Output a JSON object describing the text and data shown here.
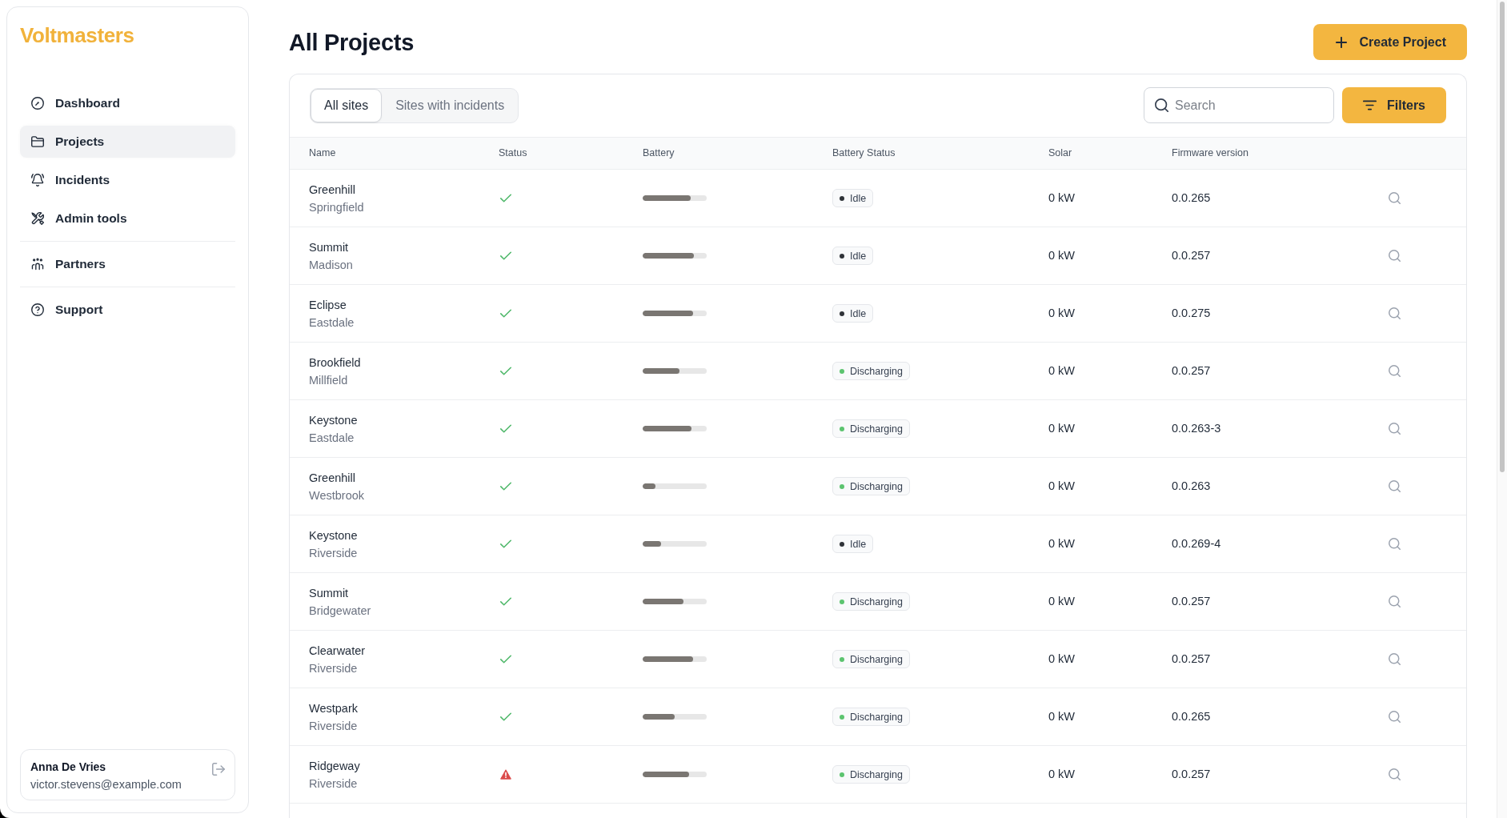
{
  "sidebar": {
    "logo": "Voltmasters",
    "nav_sections": [
      {
        "items": [
          {
            "label": "Dashboard",
            "selected": false
          },
          {
            "label": "Projects",
            "selected": true
          },
          {
            "label": "Incidents",
            "selected": false
          },
          {
            "label": "Admin tools",
            "selected": false
          }
        ]
      },
      {
        "items": [
          {
            "label": "Partners",
            "selected": false
          }
        ]
      },
      {
        "items": [
          {
            "label": "Support",
            "selected": false
          }
        ]
      }
    ],
    "user": {
      "name": "Anna De Vries",
      "email": "victor.stevens@example.com"
    }
  },
  "page": {
    "title": "All Projects",
    "create_button": "Create Project"
  },
  "toolbar": {
    "tabs": [
      {
        "label": "All sites",
        "selected": true
      },
      {
        "label": "Sites with incidents",
        "selected": false
      }
    ],
    "search": {
      "placeholder": "Search"
    },
    "filters_button": "Filters"
  },
  "table": {
    "columns": [
      "Name",
      "Status",
      "Battery",
      "Battery Status",
      "Solar",
      "Firmware version"
    ],
    "rows": [
      {
        "name": "Greenhill",
        "location": "Springfield",
        "warning": false,
        "battery": {
          "level": 0.75
        },
        "battery_status": {
          "label": "Idle",
          "color": "#2f3338"
        },
        "solar": "0 kW",
        "firmware": "0.0.265"
      },
      {
        "name": "Summit",
        "location": "Madison",
        "warning": false,
        "battery": {
          "level": 0.8
        },
        "battery_status": {
          "label": "Idle",
          "color": "#2f3338"
        },
        "solar": "0 kW",
        "firmware": "0.0.257"
      },
      {
        "name": "Eclipse",
        "location": "Eastdale",
        "warning": false,
        "battery": {
          "level": 0.79
        },
        "battery_status": {
          "label": "Idle",
          "color": "#2f3338"
        },
        "solar": "0 kW",
        "firmware": "0.0.275"
      },
      {
        "name": "Brookfield",
        "location": "Millfield",
        "warning": false,
        "battery": {
          "level": 0.57
        },
        "battery_status": {
          "label": "Discharging",
          "color": "#5cc46f"
        },
        "solar": "0 kW",
        "firmware": "0.0.257"
      },
      {
        "name": "Keystone",
        "location": "Eastdale",
        "warning": false,
        "battery": {
          "level": 0.76
        },
        "battery_status": {
          "label": "Discharging",
          "color": "#5cc46f"
        },
        "solar": "0 kW",
        "firmware": "0.0.263-3"
      },
      {
        "name": "Greenhill",
        "location": "Westbrook",
        "warning": false,
        "battery": {
          "level": 0.2
        },
        "battery_status": {
          "label": "Discharging",
          "color": "#5cc46f"
        },
        "solar": "0 kW",
        "firmware": "0.0.263"
      },
      {
        "name": "Keystone",
        "location": "Riverside",
        "warning": false,
        "battery": {
          "level": 0.29
        },
        "battery_status": {
          "label": "Idle",
          "color": "#2f3338"
        },
        "solar": "0 kW",
        "firmware": "0.0.269-4"
      },
      {
        "name": "Summit",
        "location": "Bridgewater",
        "warning": false,
        "battery": {
          "level": 0.64
        },
        "battery_status": {
          "label": "Discharging",
          "color": "#5cc46f"
        },
        "solar": "0 kW",
        "firmware": "0.0.257"
      },
      {
        "name": "Clearwater",
        "location": "Riverside",
        "warning": false,
        "battery": {
          "level": 0.79
        },
        "battery_status": {
          "label": "Discharging",
          "color": "#5cc46f"
        },
        "solar": "0 kW",
        "firmware": "0.0.257"
      },
      {
        "name": "Westpark",
        "location": "Riverside",
        "warning": false,
        "battery": {
          "level": 0.5
        },
        "battery_status": {
          "label": "Discharging",
          "color": "#5cc46f"
        },
        "solar": "0 kW",
        "firmware": "0.0.265"
      },
      {
        "name": "Ridgeway",
        "location": "Riverside",
        "warning": true,
        "battery": {
          "level": 0.73
        },
        "battery_status": {
          "label": "Discharging",
          "color": "#5cc46f"
        },
        "solar": "0 kW",
        "firmware": "0.0.257"
      }
    ]
  }
}
